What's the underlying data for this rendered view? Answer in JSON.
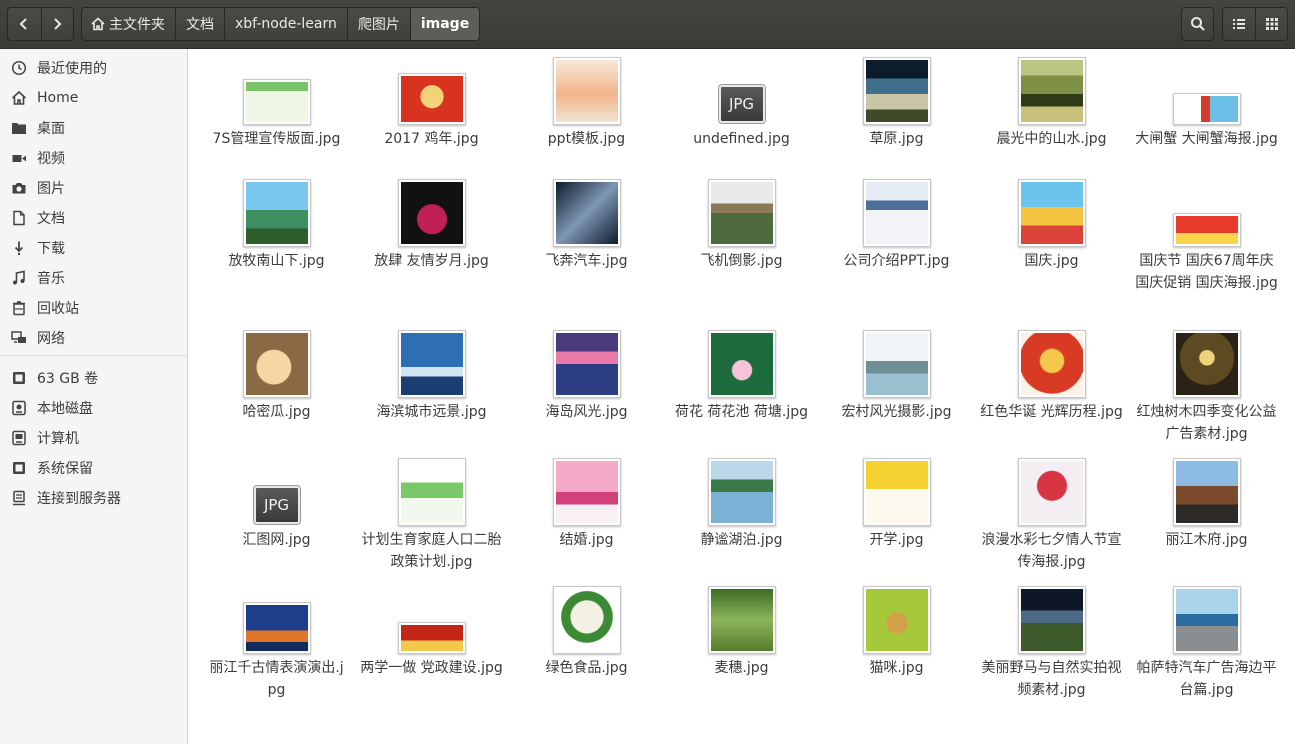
{
  "header": {
    "breadcrumbs": [
      "主文件夹",
      "文档",
      "xbf-node-learn",
      "爬图片",
      "image"
    ]
  },
  "sidebar": {
    "places": [
      "最近使用的",
      "Home",
      "桌面",
      "视频",
      "图片",
      "文档",
      "下载",
      "音乐",
      "回收站",
      "网络"
    ],
    "devices": [
      "63 GB 卷",
      "本地磁盘",
      "计算机",
      "系统保留",
      "连接到服务器"
    ]
  },
  "files": [
    {
      "name": "7S管理宣传版面.jpg",
      "kind": "thumb"
    },
    {
      "name": "2017 鸡年.jpg",
      "kind": "thumb"
    },
    {
      "name": "ppt模板.jpg",
      "kind": "thumb"
    },
    {
      "name": "undefined.jpg",
      "kind": "generic",
      "icon_text": "JPG"
    },
    {
      "name": "草原.jpg",
      "kind": "thumb"
    },
    {
      "name": "晨光中的山水.jpg",
      "kind": "thumb"
    },
    {
      "name": "大闸蟹 大闸蟹海报.jpg",
      "kind": "thumb"
    },
    {
      "name": "放牧南山下.jpg",
      "kind": "thumb"
    },
    {
      "name": "放肆 友情岁月.jpg",
      "kind": "thumb"
    },
    {
      "name": "飞奔汽车.jpg",
      "kind": "thumb"
    },
    {
      "name": "飞机倒影.jpg",
      "kind": "thumb"
    },
    {
      "name": "公司介绍PPT.jpg",
      "kind": "thumb"
    },
    {
      "name": "国庆.jpg",
      "kind": "thumb"
    },
    {
      "name": "国庆节 国庆67周年庆 国庆促销 国庆海报.jpg",
      "kind": "thumb"
    },
    {
      "name": "哈密瓜.jpg",
      "kind": "thumb"
    },
    {
      "name": "海滨城市远景.jpg",
      "kind": "thumb"
    },
    {
      "name": "海岛风光.jpg",
      "kind": "thumb"
    },
    {
      "name": "荷花 荷花池 荷塘.jpg",
      "kind": "thumb"
    },
    {
      "name": "宏村风光摄影.jpg",
      "kind": "thumb"
    },
    {
      "name": "红色华诞 光辉历程.jpg",
      "kind": "thumb"
    },
    {
      "name": "红烛树木四季变化公益广告素材.jpg",
      "kind": "thumb"
    },
    {
      "name": "汇图网.jpg",
      "kind": "generic",
      "icon_text": "JPG"
    },
    {
      "name": "计划生育家庭人口二胎政策计划.jpg",
      "kind": "thumb"
    },
    {
      "name": "结婚.jpg",
      "kind": "thumb"
    },
    {
      "name": "静谧湖泊.jpg",
      "kind": "thumb"
    },
    {
      "name": "开学.jpg",
      "kind": "thumb"
    },
    {
      "name": "浪漫水彩七夕情人节宣传海报.jpg",
      "kind": "thumb"
    },
    {
      "name": "丽江木府.jpg",
      "kind": "thumb"
    },
    {
      "name": "丽江千古情表演演出.jpg",
      "kind": "thumb"
    },
    {
      "name": "两学一做 党政建设.jpg",
      "kind": "thumb"
    },
    {
      "name": "绿色食品.jpg",
      "kind": "thumb"
    },
    {
      "name": "麦穗.jpg",
      "kind": "thumb"
    },
    {
      "name": "猫咪.jpg",
      "kind": "thumb"
    },
    {
      "name": "美丽野马与自然实拍视频素材.jpg",
      "kind": "thumb"
    },
    {
      "name": "帕萨特汽车广告海边平台篇.jpg",
      "kind": "thumb"
    }
  ]
}
